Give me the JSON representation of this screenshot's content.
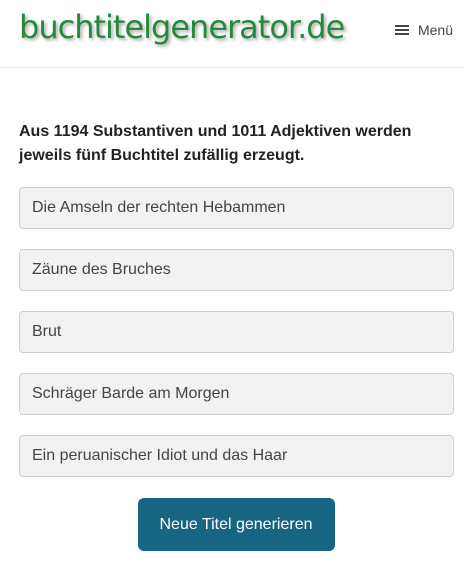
{
  "header": {
    "logo_text": "buchtitelgenerator.de",
    "menu_label": "Menü",
    "menu_icon": "hamburger-icon"
  },
  "main": {
    "intro_text": "Aus 1194 Substantiven und 1011 Adjektiven werden jeweils fünf Buchtitel zufällig erzeugt.",
    "titles": [
      "Die Amseln der rechten Hebammen",
      "Zäune des Bruches",
      "Brut",
      "Schräger Barde am Morgen",
      "Ein peruanischer Idiot und das Haar"
    ],
    "generate_button_label": "Neue Titel generieren"
  },
  "colors": {
    "logo": "#25893a",
    "button": "#176582",
    "field_background": "#f2f2f2"
  }
}
